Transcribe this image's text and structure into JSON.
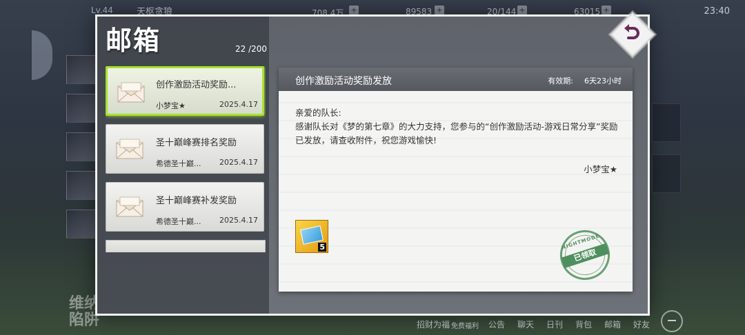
{
  "background": {
    "level": "Lv.44",
    "nickname": "天枢贪狼",
    "resources": [
      "708.4万",
      "89583",
      "20/144",
      "63015"
    ],
    "clock": "23:40",
    "event_text": "维纳斯\n陷阱",
    "bottom_nav": [
      "招财为福",
      "免费福利",
      "公告",
      "聊天",
      "日刊",
      "背包",
      "邮箱",
      "好友"
    ]
  },
  "mailbox": {
    "title": "邮箱",
    "count": "22 /200",
    "mails": [
      {
        "title": "创作激励活动奖励...",
        "sender": "小梦宝★",
        "date": "2025.4.17",
        "selected": true
      },
      {
        "title": "圣十巅峰赛排名奖励",
        "sender": "希德圣十巅...",
        "date": "2025.4.17",
        "selected": false
      },
      {
        "title": "圣十巅峰赛补发奖励",
        "sender": "希德圣十巅...",
        "date": "2025.4.17",
        "selected": false
      }
    ]
  },
  "letter": {
    "subject": "创作激励活动奖励发放",
    "validity_label": "有效期:",
    "validity_value": "6天23小时",
    "greeting": "亲爱的队长:",
    "body": "感谢队长对《梦的第七章》的大力支持，您参与的“创作激励活动-游戏日常分享”奖励已发放，请查收附件，祝您游戏愉快!",
    "signature": "小梦宝★",
    "attachment_count": "5",
    "stamp_brand": "NIGHTMODE",
    "stamp_text": "已领取"
  },
  "icons": {
    "back": "back-arrow-icon",
    "envelope": "envelope-icon"
  },
  "colors": {
    "selected_border": "#a6e22e",
    "stamp": "#4f8f5d",
    "letter_header": "#5f6268"
  }
}
